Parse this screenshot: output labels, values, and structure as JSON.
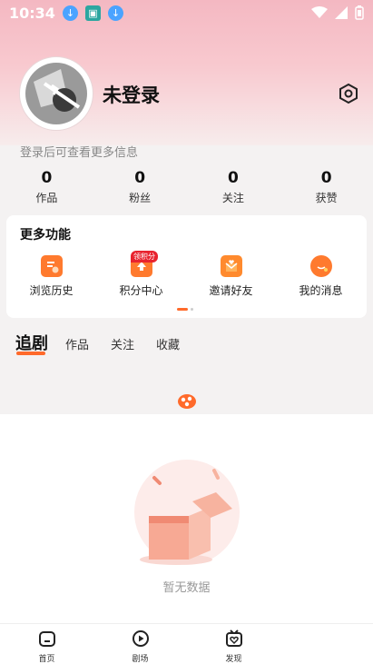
{
  "status_bar": {
    "time": "10:34",
    "left_icons": [
      "download-icon",
      "app-icon",
      "download-icon"
    ],
    "right_icons": [
      "wifi-icon",
      "signal-icon",
      "battery-icon"
    ]
  },
  "profile": {
    "username": "未登录",
    "login_hint": "登录后可查看更多信息",
    "settings_icon": "settings-hex-icon"
  },
  "stats": [
    {
      "value": "0",
      "label": "作品"
    },
    {
      "value": "0",
      "label": "粉丝"
    },
    {
      "value": "0",
      "label": "关注"
    },
    {
      "value": "0",
      "label": "获赞"
    }
  ],
  "more_functions": {
    "title": "更多功能",
    "items": [
      {
        "label": "浏览历史",
        "icon": "history-icon",
        "color": "#ff7a2e"
      },
      {
        "label": "积分中心",
        "icon": "points-icon",
        "color": "#ff7a2e",
        "badge": "领积分"
      },
      {
        "label": "邀请好友",
        "icon": "invite-envelope-icon",
        "color": "#ff8a2e"
      },
      {
        "label": "我的消息",
        "icon": "message-bubble-icon",
        "color": "#ff7a2e"
      }
    ]
  },
  "tabs": [
    {
      "label": "追剧",
      "active": true
    },
    {
      "label": "作品",
      "active": false
    },
    {
      "label": "关注",
      "active": false
    },
    {
      "label": "收藏",
      "active": false
    }
  ],
  "empty_state": {
    "text": "暂无数据"
  },
  "bottom_nav": [
    {
      "label": "首页",
      "icon": "home-icon"
    },
    {
      "label": "剧场",
      "icon": "play-circle-icon"
    },
    {
      "label": "发现",
      "icon": "tv-heart-icon"
    }
  ],
  "colors": {
    "accent": "#ff6a2b",
    "badge": "#e8232f"
  }
}
